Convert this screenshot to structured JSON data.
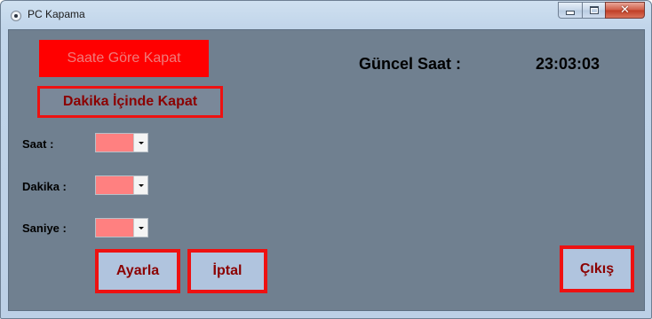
{
  "window": {
    "title": "PC Kapama"
  },
  "buttons": {
    "shutdown_by_time": "Saate Göre Kapat",
    "shutdown_in_minutes": "Dakika İçinde Kapat",
    "set": "Ayarla",
    "cancel": "İptal",
    "exit": "Çıkış"
  },
  "clock": {
    "label": "Güncel Saat :",
    "time": "23:03:03"
  },
  "fields": {
    "hour_label": "Saat :",
    "minute_label": "Dakika :",
    "second_label": "Saniye :"
  },
  "icons": {
    "app": "app-icon",
    "minimize": "minimize-icon",
    "maximize": "maximize-icon",
    "close": "close-icon",
    "dropdown": "chevron-down-icon"
  },
  "colors": {
    "client_background": "#708090",
    "accent_red": "#ff0000",
    "button_text": "#8b0000",
    "combo_fill": "#ff8080",
    "button_fill": "#b0c4de"
  }
}
